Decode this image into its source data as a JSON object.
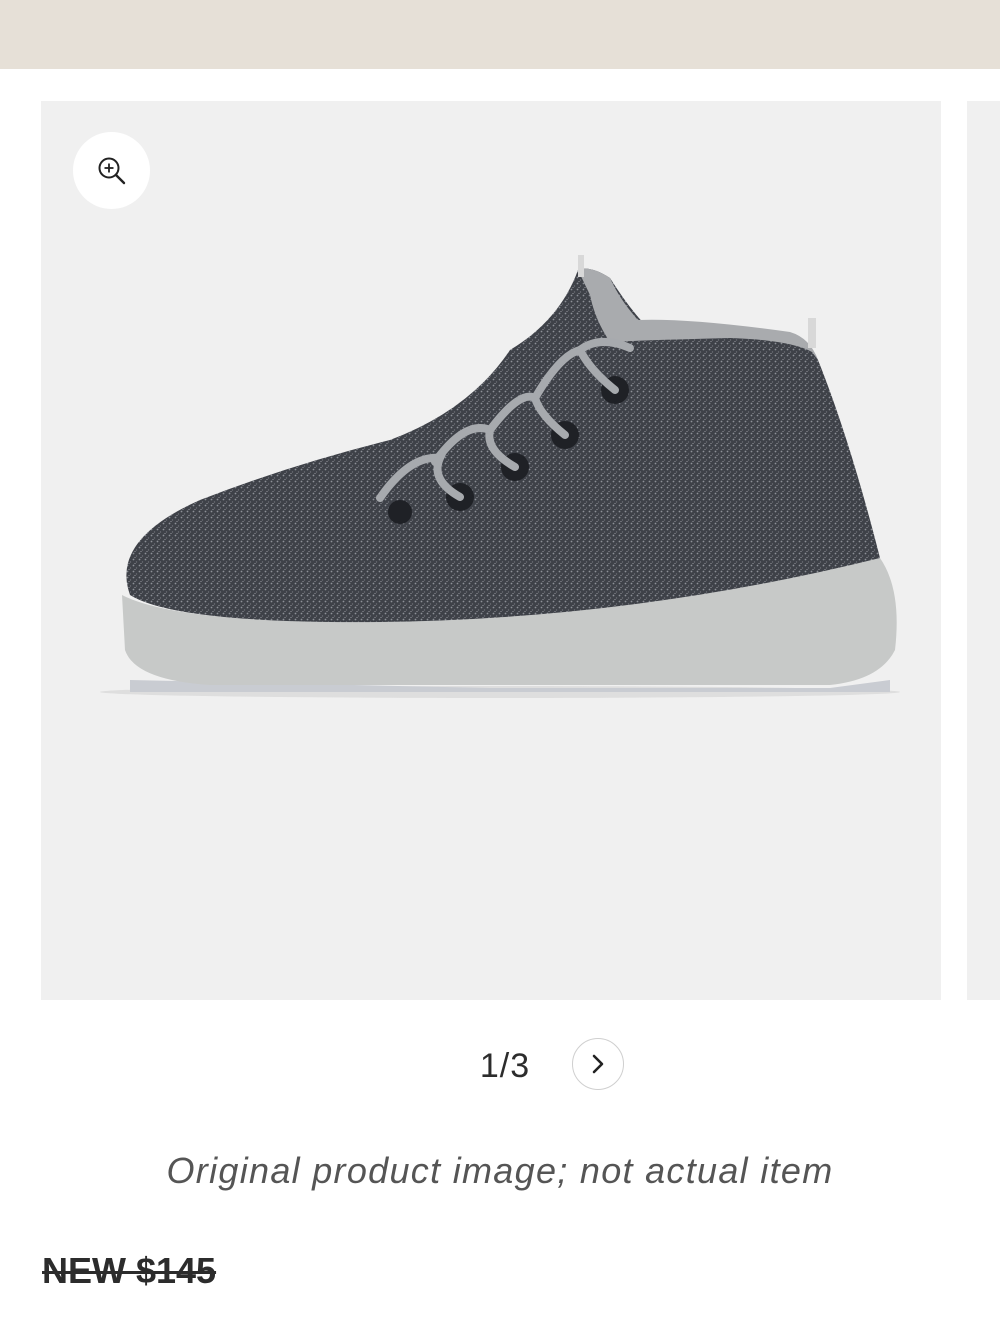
{
  "header": {
    "bar_color": "#e6e0d7"
  },
  "gallery": {
    "zoom_icon": "zoom-in-icon",
    "next_icon": "chevron-right-icon",
    "counter": "1/3",
    "current_index": 1,
    "total": 3,
    "image_background": "#f0f0f0"
  },
  "product": {
    "disclaimer": "Original product image; not actual item",
    "price_label": "NEW $145"
  }
}
